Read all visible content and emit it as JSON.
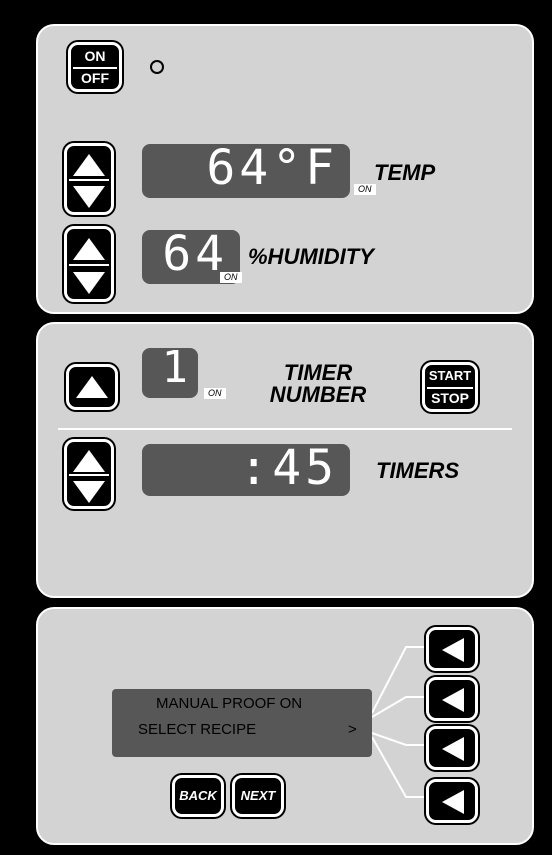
{
  "power": {
    "on_label": "ON",
    "off_label": "OFF"
  },
  "temp": {
    "value": "64°F",
    "label": "TEMP",
    "on_badge": "ON"
  },
  "humidity": {
    "value": "64",
    "label": "%HUMIDITY",
    "on_badge": "ON"
  },
  "timer": {
    "number": "1",
    "on_badge": "ON",
    "label_line1": "TIMER",
    "label_line2": "NUMBER",
    "start_label": "START",
    "stop_label": "STOP",
    "time": ":45",
    "timers_label": "TIMERS"
  },
  "menu": {
    "line1": "MANUAL PROOF ON",
    "line2": "SELECT RECIPE",
    "line2_arrow": ">",
    "back_label": "BACK",
    "next_label": "NEXT"
  }
}
